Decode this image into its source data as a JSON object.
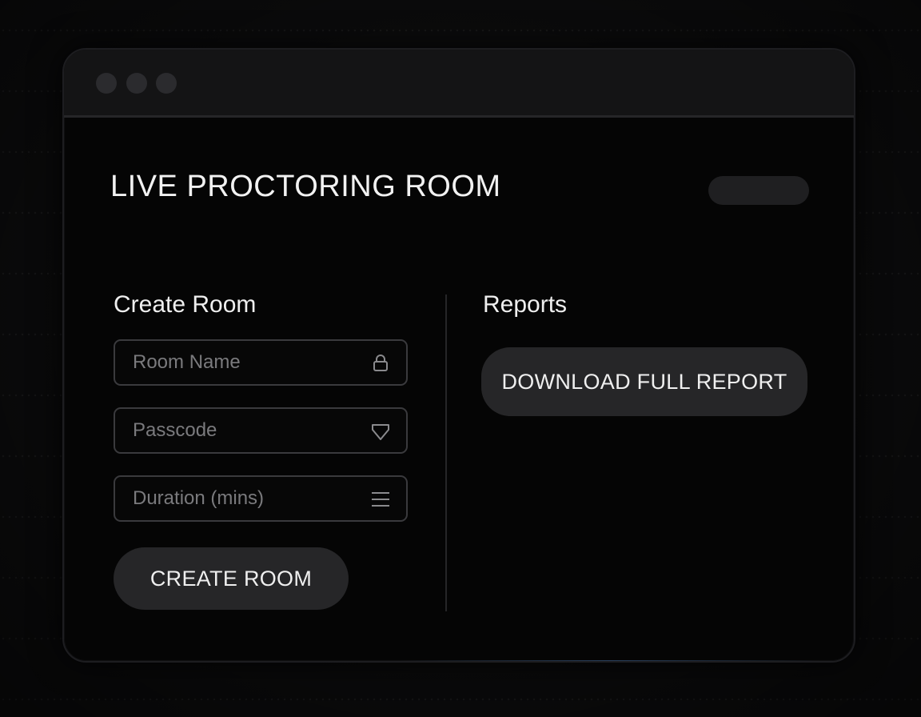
{
  "window": {
    "controls": [
      "window-dot",
      "window-dot",
      "window-dot"
    ]
  },
  "header": {
    "title": "LIVE PROCTORING ROOM"
  },
  "create_room": {
    "heading": "Create Room",
    "fields": [
      {
        "placeholder": "Room Name",
        "value": "",
        "icon": "lock-icon"
      },
      {
        "placeholder": "Passcode",
        "value": "",
        "icon": "shield-icon"
      },
      {
        "placeholder": "Duration (mins)",
        "value": "",
        "icon": "menu-icon"
      }
    ],
    "button_label": "CREATE ROOM"
  },
  "reports": {
    "heading": "Reports",
    "button_label": "DOWNLOAD FULL REPORT"
  },
  "colors": {
    "background": "#0c0c0d",
    "window": "#050505",
    "titlebar": "#141415",
    "button": "#262628",
    "text": "#f2f2f2",
    "placeholder": "#7a7a7d"
  }
}
